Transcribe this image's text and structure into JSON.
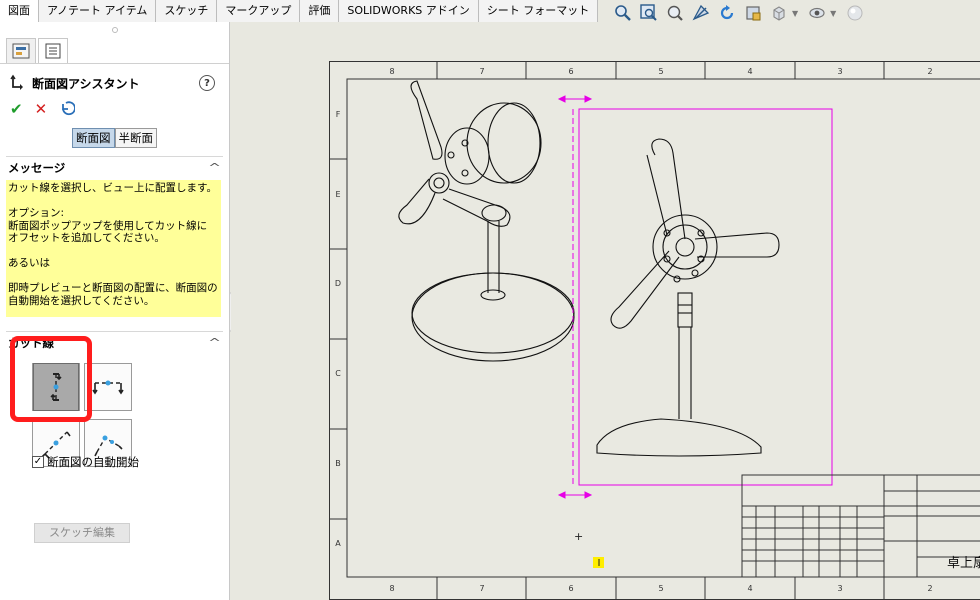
{
  "tabs": [
    "図面",
    "アノテート アイテム",
    "スケッチ",
    "マークアップ",
    "評価",
    "SOLIDWORKS アドイン",
    "シート フォーマット"
  ],
  "panel": {
    "title": "断面図アシスタント",
    "help": "?",
    "ok": "✔",
    "cancel": "✕",
    "mode_full": "断面図",
    "mode_half": "半断面",
    "messages_title": "メッセージ",
    "message_lines": [
      "カット線を選択し、ビュー上に配置します。",
      "",
      "オプション:",
      "断面図ポップアップを使用してカット線に",
      "オフセットを追加してください。",
      "",
      "あるいは",
      "",
      "即時プレビューと断面図の配置に、断面図の",
      "自動開始を選択してください。"
    ],
    "cutline_title": "カット線",
    "auto_start_label": "断面図の自動開始",
    "auto_start_checked": "✓",
    "sketch_edit": "スケッチ編集"
  },
  "sheet": {
    "top_numbers": [
      "8",
      "7",
      "6",
      "5",
      "4",
      "3",
      "2"
    ],
    "bottom_numbers": [
      "8",
      "7",
      "6",
      "5",
      "4",
      "3",
      "2"
    ],
    "side_letters": [
      "F",
      "E",
      "D",
      "C",
      "B",
      "A"
    ],
    "title_block_text": "卓上扇",
    "cursor_mark": "+"
  },
  "colors": {
    "selection": "#e600e6",
    "message_bg": "#ffff99",
    "highlight": "#ff1d1d"
  }
}
